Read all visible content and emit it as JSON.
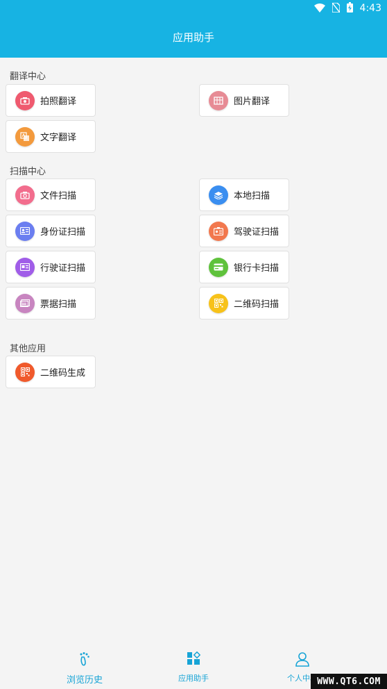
{
  "status_bar": {
    "time": "4:43",
    "icons": [
      "wifi-icon",
      "no-sim-icon",
      "battery-charging-icon"
    ]
  },
  "header": {
    "title": "应用助手"
  },
  "sections": {
    "translate": {
      "title": "翻译中心",
      "items": [
        {
          "label": "拍照翻译",
          "icon": "camera-icon",
          "color": "#ef5a6f"
        },
        {
          "label": "图片翻译",
          "icon": "image-grid-icon",
          "color": "#e78b95"
        },
        {
          "label": "文字翻译",
          "icon": "text-translate-icon",
          "color": "#f39a3d"
        }
      ]
    },
    "scan": {
      "title": "扫描中心",
      "items": [
        {
          "label": "文件扫描",
          "icon": "camera-icon",
          "color": "#f26d8d"
        },
        {
          "label": "本地扫描",
          "icon": "layers-icon",
          "color": "#3a8ef0"
        },
        {
          "label": "身份证扫描",
          "icon": "id-card-icon",
          "color": "#6b7ef0"
        },
        {
          "label": "驾驶证扫描",
          "icon": "license-icon",
          "color": "#f2784e"
        },
        {
          "label": "行驶证扫描",
          "icon": "vehicle-card-icon",
          "color": "#a05de8"
        },
        {
          "label": "银行卡扫描",
          "icon": "bank-card-icon",
          "color": "#5fc23c"
        },
        {
          "label": "票据扫描",
          "icon": "ticket-icon",
          "color": "#c885c0"
        },
        {
          "label": "二维码扫描",
          "icon": "qr-code-icon",
          "color": "#f7c21a"
        }
      ]
    },
    "other": {
      "title": "其他应用",
      "items": [
        {
          "label": "二维码生成",
          "icon": "qr-code-icon",
          "color": "#f05a2c"
        }
      ]
    }
  },
  "bottom_nav": {
    "history": {
      "label": "浏览历史",
      "icon": "footprint-icon"
    },
    "apps": {
      "label": "应用助手",
      "icon": "apps-grid-icon"
    },
    "profile": {
      "label": "个人中心",
      "icon": "person-icon"
    }
  },
  "watermark": "WWW.QT6.COM",
  "colors": {
    "accent": "#17b3e3",
    "nav_text": "#17a4d6",
    "background": "#f4f4f4"
  }
}
